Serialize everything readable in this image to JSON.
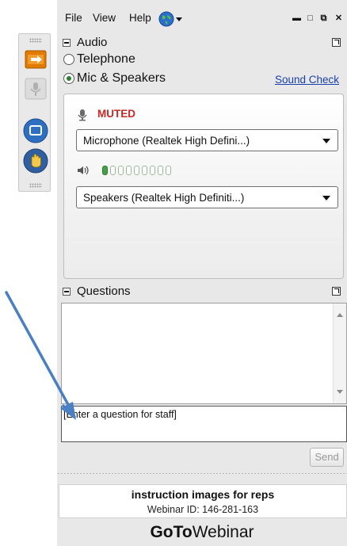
{
  "menu": {
    "file": "File",
    "view": "View",
    "help": "Help"
  },
  "audio": {
    "title": "Audio",
    "telephone_label": "Telephone",
    "mic_speakers_label": "Mic & Speakers",
    "selected_mode": "Mic & Speakers",
    "sound_check_link": "Sound Check",
    "muted_label": "MUTED",
    "microphone_device": "Microphone (Realtek High Defini...)",
    "speakers_device": "Speakers (Realtek High Definiti...)",
    "level_segments_on": 1,
    "level_segments_total": 9
  },
  "questions": {
    "title": "Questions",
    "input_placeholder": "[Enter a question for staff]",
    "send_label": "Send"
  },
  "webinar": {
    "title": "instruction images for reps",
    "id_text": "Webinar ID: 146-281-163"
  },
  "brand": {
    "go": "Go",
    "to": "To",
    "product": "Webinar"
  },
  "colors": {
    "muted": "#c62828",
    "link": "#1a3faa",
    "arrow": "#4a7fc4",
    "show_screen_btn": "#e07b00",
    "hand_btn": "#2f5fa0"
  }
}
